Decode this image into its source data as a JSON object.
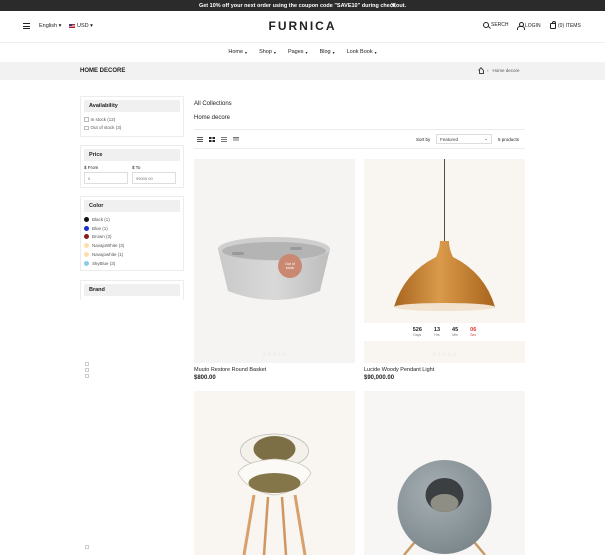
{
  "announcement": {
    "text": "Get 10% off your next order using the coupon code \"SAVE10\" during checkout.",
    "close": "✕"
  },
  "header": {
    "language": "English ▾",
    "currency": "USD ▾",
    "logo": "FURNICA",
    "search": "SERCH",
    "login": "LOGIN",
    "cart": "(0) ITEMS"
  },
  "nav": [
    {
      "label": "Home"
    },
    {
      "label": "Shop"
    },
    {
      "label": "Pages"
    },
    {
      "label": "Blog"
    },
    {
      "label": "Look Book"
    }
  ],
  "breadcrumb": {
    "title": "HOME DECORE",
    "separator": "›",
    "current": "Home decore"
  },
  "filters": {
    "availability": {
      "title": "Availability",
      "options": [
        "In stock (12)",
        "Out of stock (3)"
      ]
    },
    "price": {
      "title": "Price",
      "from_label": "$ From",
      "to_label": "$ To",
      "from_placeholder": "0",
      "to_placeholder": "99000.00"
    },
    "color": {
      "title": "Color",
      "options": [
        {
          "label": "Black (1)",
          "color": "#111111"
        },
        {
          "label": "Blue (1)",
          "color": "#1b2fd1"
        },
        {
          "label": "Brown (3)",
          "color": "#8b1a1a"
        },
        {
          "label": "NavajoWhite (3)",
          "color": "#ffdead"
        },
        {
          "label": "Navajowhite (1)",
          "color": "#ffdead"
        },
        {
          "label": "SkyBlue (3)",
          "color": "#87ceeb"
        }
      ]
    },
    "brand": {
      "title": "Brand"
    }
  },
  "main": {
    "crumb_all": "All Collections",
    "crumb_current": "Home decore",
    "sort_label": "Sort by",
    "sort_value": "Featured",
    "product_count": "5 products"
  },
  "products": [
    {
      "title": "Muuto Restore Round Basket",
      "price": "$800.00",
      "badge_line1": "Out of",
      "badge_line2": "stock",
      "stars": "☆☆☆☆☆"
    },
    {
      "title": "Lucide Woody Pendant Light",
      "price": "$90,000.00",
      "stars": "☆☆☆☆☆",
      "countdown": [
        {
          "num": "526",
          "unit": "Days"
        },
        {
          "num": "13",
          "unit": "Hrs"
        },
        {
          "num": "45",
          "unit": "Min"
        },
        {
          "num": "06",
          "unit": "Sec"
        }
      ]
    },
    {
      "title": "",
      "price": ""
    },
    {
      "title": "",
      "price": ""
    }
  ]
}
